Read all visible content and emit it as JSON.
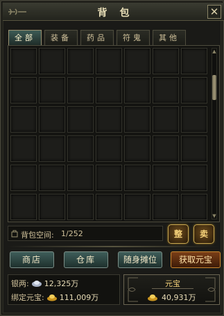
{
  "window": {
    "title": "背包",
    "close_icon": "close-icon"
  },
  "tabs": [
    {
      "label": "全部",
      "active": true
    },
    {
      "label": "装备",
      "active": false
    },
    {
      "label": "药品",
      "active": false
    },
    {
      "label": "符鬼",
      "active": false
    },
    {
      "label": "其他",
      "active": false
    }
  ],
  "inventory": {
    "slot_count": 42,
    "capacity_label": "背包空间:",
    "capacity_value": "1/252"
  },
  "buttons": {
    "sort": "整",
    "sell": "卖",
    "shop": "商店",
    "warehouse": "仓库",
    "stall": "随身摊位",
    "get_ingot": "获取元宝"
  },
  "currency": {
    "silver_label": "银两:",
    "silver_value": "12,325万",
    "bound_label": "绑定元宝:",
    "bound_value": "111,009万",
    "ingot_title": "元宝",
    "ingot_value": "40,931万"
  },
  "colors": {
    "accent_gold": "#f5d27a",
    "tab_active": "#3d5b55",
    "ingot_button": "#7a3e17"
  }
}
